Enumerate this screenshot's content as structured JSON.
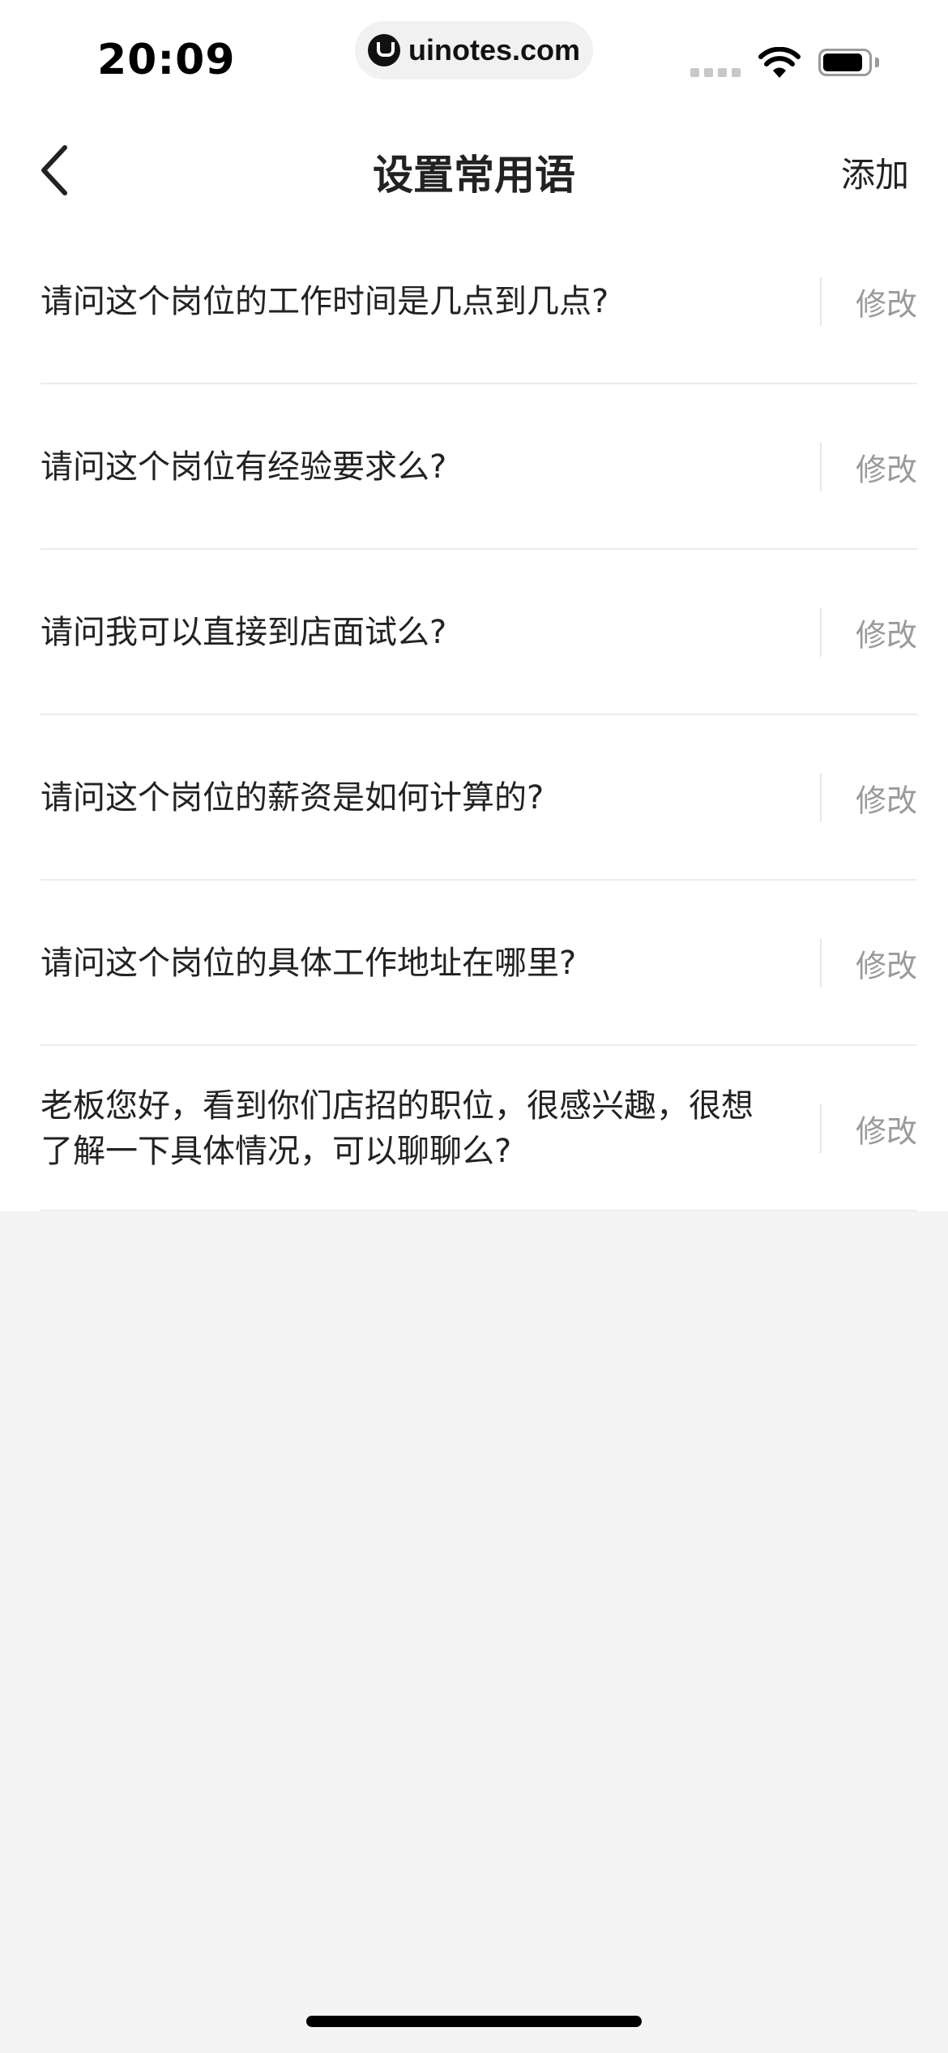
{
  "status_bar": {
    "time": "20:09",
    "url": "uinotes.com"
  },
  "nav": {
    "title": "设置常用语",
    "add_label": "添加"
  },
  "phrases": [
    {
      "text": "请问这个岗位的工作时间是几点到几点?",
      "edit_label": "修改"
    },
    {
      "text": "请问这个岗位有经验要求么?",
      "edit_label": "修改"
    },
    {
      "text": "请问我可以直接到店面试么?",
      "edit_label": "修改"
    },
    {
      "text": "请问这个岗位的薪资是如何计算的?",
      "edit_label": "修改"
    },
    {
      "text": "请问这个岗位的具体工作地址在哪里?",
      "edit_label": "修改"
    },
    {
      "text": "老板您好，看到你们店招的职位，很感兴趣，很想了解一下具体情况，可以聊聊么?",
      "edit_label": "修改"
    }
  ]
}
